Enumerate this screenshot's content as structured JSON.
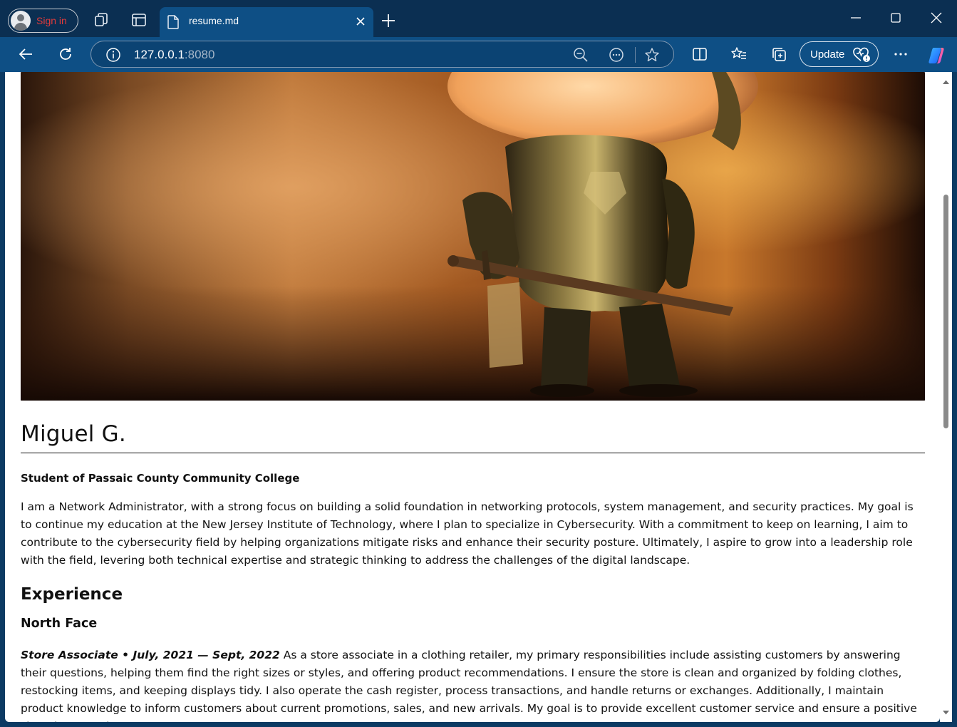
{
  "browser": {
    "signin_label": "Sign in",
    "tab_title": "resume.md",
    "address_host": "127.0.0.1",
    "address_port": ":8080",
    "update_label": "Update"
  },
  "colors": {
    "chrome_dark": "#0b2f52",
    "chrome_nav": "#0e4f85",
    "signin_text": "#e23b3b"
  },
  "icons": [
    "profile-avatar-icon",
    "workspaces-icon",
    "tab-actions-icon",
    "document-icon",
    "close-tab-icon",
    "new-tab-icon",
    "minimize-icon",
    "maximize-icon",
    "close-window-icon",
    "back-icon",
    "refresh-icon",
    "site-info-icon",
    "zoom-out-icon",
    "read-aloud-icon",
    "favorite-star-icon",
    "split-screen-icon",
    "favorites-icon",
    "collections-icon",
    "browser-essentials-icon",
    "more-icon",
    "copilot-icon"
  ],
  "page": {
    "hero_alt": "Funko figure of an armored knight holding a sword",
    "name": "Miguel G.",
    "subtitle": "Student of Passaic County Community College",
    "intro": "I am a Network Administrator, with a strong focus on building a solid foundation in networking protocols, system management, and security practices. My goal is to continue my education at the New Jersey Institute of Technology, where I plan to specialize in Cybersecurity. With a commitment to keep on learning, I aim to contribute to the cybersecurity field by helping organizations mitigate risks and enhance their security posture. Ultimately, I aspire to grow into a leadership role with the field, levering both technical expertise and strategic thinking to address the challenges of the digital landscape.",
    "experience_heading": "Experience",
    "jobs": [
      {
        "company": "North Face",
        "title_dates": "Store Associate • July, 2021 — Sept, 2022",
        "description": " As a store associate in a clothing retailer, my primary responsibilities include assisting customers by answering their questions, helping them find the right sizes or styles, and offering product recommendations. I ensure the store is clean and organized by folding clothes, restocking items, and keeping displays tidy. I also operate the cash register, process transactions, and handle returns or exchanges. Additionally, I maintain product knowledge to inform customers about current promotions, sales, and new arrivals. My goal is to provide excellent customer service and ensure a positive shopping experience."
      }
    ]
  }
}
